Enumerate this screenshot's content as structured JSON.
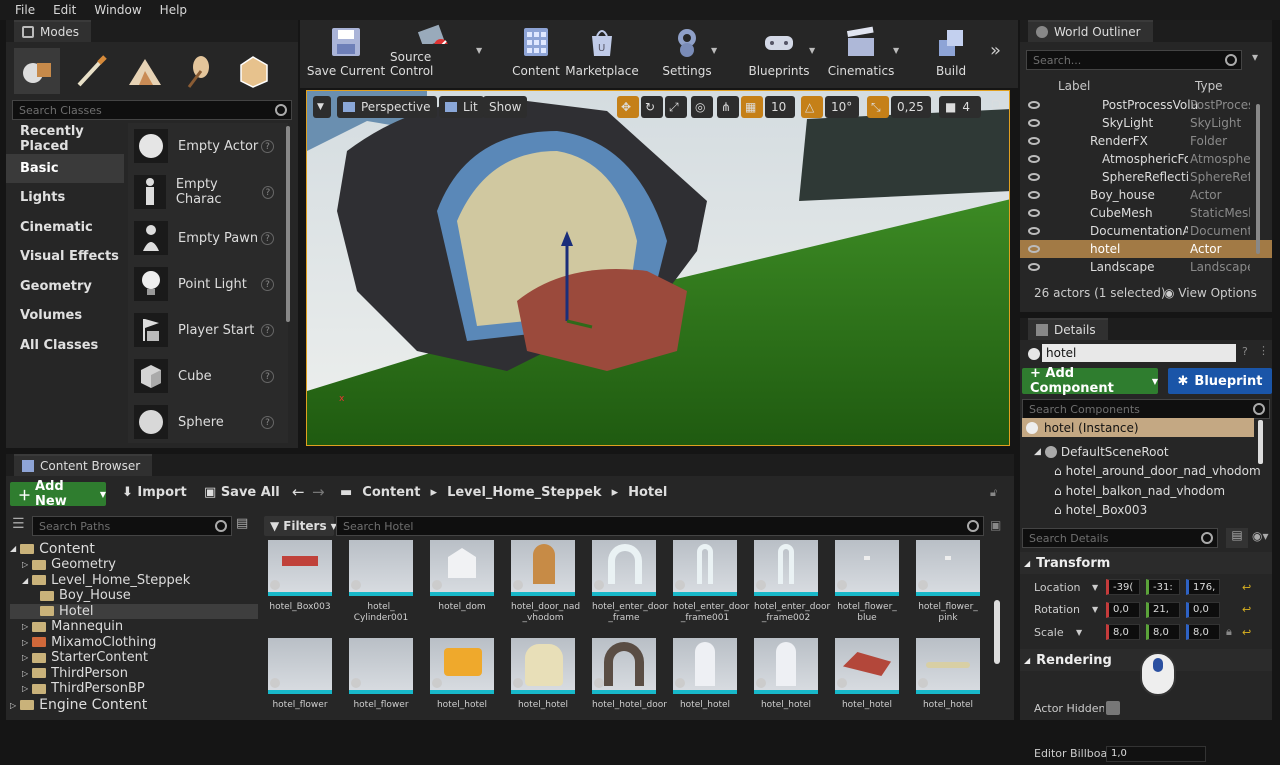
{
  "menu": [
    "File",
    "Edit",
    "Window",
    "Help"
  ],
  "modes": {
    "tab": "Modes",
    "search_placeholder": "Search Classes",
    "categories": [
      "Recently Placed",
      "Basic",
      "Lights",
      "Cinematic",
      "Visual Effects",
      "Geometry",
      "Volumes",
      "All Classes"
    ],
    "items": [
      "Empty Actor",
      "Empty Charac",
      "Empty Pawn",
      "Point Light",
      "Player Start",
      "Cube",
      "Sphere"
    ]
  },
  "toolbar": [
    "Save Current",
    "Source Control",
    "Content",
    "Marketplace",
    "Settings",
    "Blueprints",
    "Cinematics",
    "Build"
  ],
  "viewport": {
    "perspective": "Perspective",
    "lit": "Lit",
    "show": "Show",
    "grid": "10",
    "angle": "10°",
    "scale": "0,25",
    "speed": "4"
  },
  "outliner": {
    "tab": "World Outliner",
    "search_placeholder": "Search...",
    "col_label": "Label",
    "col_type": "Type",
    "rows": [
      {
        "label": "PostProcessVolu",
        "type": "PostProces"
      },
      {
        "label": "SkyLight",
        "type": "SkyLight"
      },
      {
        "label": "RenderFX",
        "type": "Folder"
      },
      {
        "label": "AtmosphericFog",
        "type": "Atmospheri"
      },
      {
        "label": "SphereReflectior",
        "type": "SphereRefle"
      },
      {
        "label": "Boy_house",
        "type": "Actor"
      },
      {
        "label": "CubeMesh",
        "type": "StaticMesh"
      },
      {
        "label": "DocumentationAct",
        "type": "Documenta"
      },
      {
        "label": "hotel",
        "type": "Actor"
      },
      {
        "label": "Landscape",
        "type": "Landscape"
      }
    ],
    "status": "26 actors (1 selected)",
    "view_options": "View Options"
  },
  "details": {
    "tab": "Details",
    "name": "hotel",
    "add_component": "+ Add Component",
    "blueprint": "Blueprint",
    "search_components": "Search Components",
    "instance": "hotel (Instance)",
    "components": [
      "DefaultSceneRoot",
      "hotel_around_door_nad_vhodom",
      "hotel_balkon_nad_vhodom",
      "hotel_Box003"
    ],
    "search_details": "Search Details",
    "transform": "Transform",
    "location_label": "Location",
    "rotation_label": "Rotation",
    "scale_label": "Scale",
    "location": [
      "-39(",
      "-31:",
      "176,"
    ],
    "rotation": [
      "0,0",
      "21,",
      "0,0"
    ],
    "scale": [
      "8,0",
      "8,0",
      "8,0"
    ],
    "rendering": "Rendering",
    "actor_hidden": "Actor Hidden In",
    "editor_billboard": "Editor Billboard",
    "billboard_val": "1,0"
  },
  "content": {
    "tab": "Content Browser",
    "add_new": "Add New",
    "import": "Import",
    "save_all": "Save All",
    "path": [
      "Content",
      "Level_Home_Steppek",
      "Hotel"
    ],
    "search_paths": "Search Paths",
    "filters": "Filters",
    "search_placeholder": "Search Hotel",
    "tree": [
      "Content",
      "Geometry",
      "Level_Home_Steppek",
      "Boy_House",
      "Hotel",
      "Mannequin",
      "MixamoClothing",
      "StarterContent",
      "ThirdPerson",
      "ThirdPersonBP",
      "Engine Content"
    ],
    "assets": [
      "hotel_Box003",
      "hotel_\nCylinder001",
      "hotel_dom",
      "hotel_door_nad\n_vhodom",
      "hotel_enter_door\n_frame",
      "hotel_enter_door\n_frame001",
      "hotel_enter_door\n_frame002",
      "hotel_flower_\nblue",
      "hotel_flower_\npink"
    ],
    "assets_row2": [
      "hotel_flower",
      "hotel_flower",
      "hotel_hotel",
      "hotel_hotel",
      "hotel_hotel_door",
      "hotel_hotel",
      "hotel_hotel",
      "hotel_hotel",
      "hotel_hotel"
    ]
  },
  "colors": {
    "selected": "#a27a45",
    "green": "#2f7d2f",
    "blue": "#1a55a8",
    "accent": "#18b8c9"
  }
}
